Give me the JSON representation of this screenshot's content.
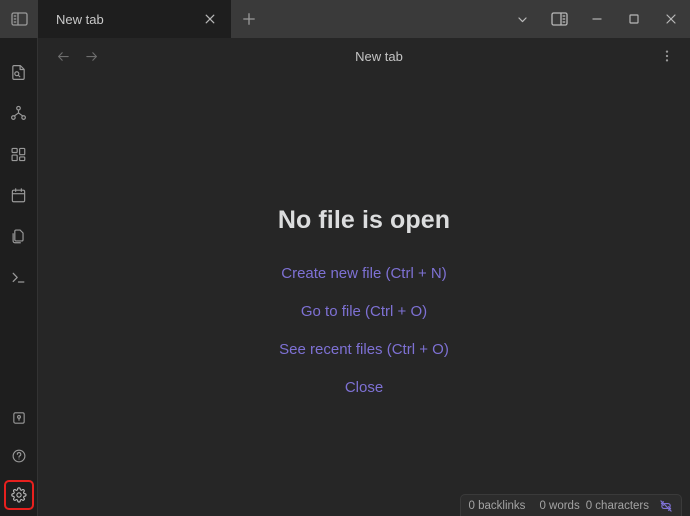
{
  "window": {
    "sidebar_toggle_icon": "left-sidebar-toggle-icon",
    "controls": [
      {
        "name": "chevron-down-icon",
        "label": ""
      },
      {
        "name": "right-sidebar-toggle-icon",
        "label": ""
      },
      {
        "name": "minimize-icon",
        "label": ""
      },
      {
        "name": "maximize-icon",
        "label": ""
      },
      {
        "name": "close-icon",
        "label": ""
      }
    ]
  },
  "tabs": {
    "items": [
      {
        "title": "New tab",
        "active": true
      }
    ],
    "close_icon": "close-icon",
    "new_tab_icon": "plus-icon"
  },
  "ribbon": {
    "top_items": [
      {
        "name": "file-search-icon",
        "label": "Quick switcher"
      },
      {
        "name": "graph-icon",
        "label": "Graph view"
      },
      {
        "name": "canvas-grid-icon",
        "label": "Canvas"
      },
      {
        "name": "calendar-icon",
        "label": "Daily note"
      },
      {
        "name": "copy-files-icon",
        "label": "Templates"
      },
      {
        "name": "terminal-icon",
        "label": "Terminal"
      }
    ],
    "bottom_items": [
      {
        "name": "vault-icon",
        "label": "Open another vault"
      },
      {
        "name": "help-icon",
        "label": "Help"
      },
      {
        "name": "settings-gear-icon",
        "label": "Settings",
        "highlighted": true
      }
    ],
    "highlight_color": "#e8201e"
  },
  "view": {
    "back_icon": "arrow-left-icon",
    "forward_icon": "arrow-right-icon",
    "title": "New tab",
    "menu_icon": "more-vertical-icon"
  },
  "empty_state": {
    "title": "No file is open",
    "actions": [
      {
        "label": "Create new file (Ctrl + N)"
      },
      {
        "label": "Go to file (Ctrl + O)"
      },
      {
        "label": "See recent files (Ctrl + O)"
      },
      {
        "label": "Close"
      }
    ],
    "link_color": "#7e71d4"
  },
  "statusbar": {
    "backlinks": "0 backlinks",
    "words": "0 words",
    "characters": "0 characters",
    "sync_icon": "sync-disabled-icon"
  },
  "colors": {
    "titlebar_bg": "#3a3a3a",
    "tab_active_bg": "#1e1e1e",
    "ribbon_bg": "#1e1e1e",
    "content_bg": "#262626",
    "accent": "#7e71d4"
  }
}
